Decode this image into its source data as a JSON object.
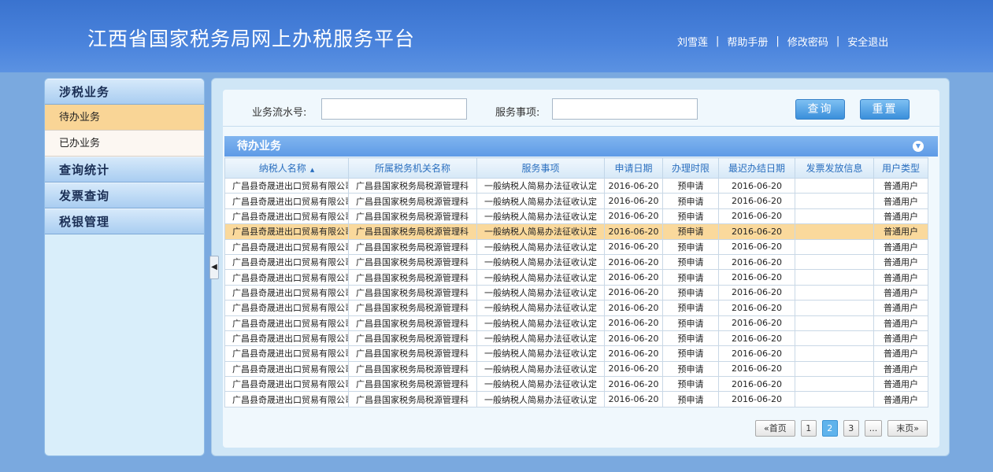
{
  "header": {
    "title": "江西省国家税务局网上办税服务平台",
    "user": "刘雪莲",
    "help": "帮助手册",
    "change_password": "修改密码",
    "logout": "安全退出",
    "separator": "|"
  },
  "sidebar": {
    "section_tax": "涉税业务",
    "item_pending": "待办业务",
    "item_done": "已办业务",
    "section_query": "查询统计",
    "section_invoice": "发票查询",
    "section_bank": "税银管理"
  },
  "search": {
    "serial_label": "业务流水号:",
    "serial_value": "",
    "service_label": "服务事项:",
    "service_value": "",
    "query_button": "查询",
    "reset_button": "重置"
  },
  "panel": {
    "title": "待办业务"
  },
  "table": {
    "columns": [
      "纳税人名称",
      "所属税务机关名称",
      "服务事项",
      "申请日期",
      "办理时限",
      "最迟办结日期",
      "发票发放信息",
      "用户类型"
    ],
    "rows": [
      [
        "广昌县奇晟进出口贸易有限公司",
        "广昌县国家税务局税源管理科",
        "一般纳税人简易办法征收认定",
        "2016-06-20",
        "预申请",
        "2016-06-20",
        "",
        "普通用户"
      ],
      [
        "广昌县奇晟进出口贸易有限公司",
        "广昌县国家税务局税源管理科",
        "一般纳税人简易办法征收认定",
        "2016-06-20",
        "预申请",
        "2016-06-20",
        "",
        "普通用户"
      ],
      [
        "广昌县奇晟进出口贸易有限公司",
        "广昌县国家税务局税源管理科",
        "一般纳税人简易办法征收认定",
        "2016-06-20",
        "预申请",
        "2016-06-20",
        "",
        "普通用户"
      ],
      [
        "广昌县奇晟进出口贸易有限公司",
        "广昌县国家税务局税源管理科",
        "一般纳税人简易办法征收认定",
        "2016-06-20",
        "预申请",
        "2016-06-20",
        "",
        "普通用户"
      ],
      [
        "广昌县奇晟进出口贸易有限公司",
        "广昌县国家税务局税源管理科",
        "一般纳税人简易办法征收认定",
        "2016-06-20",
        "预申请",
        "2016-06-20",
        "",
        "普通用户"
      ],
      [
        "广昌县奇晟进出口贸易有限公司",
        "广昌县国家税务局税源管理科",
        "一般纳税人简易办法征收认定",
        "2016-06-20",
        "预申请",
        "2016-06-20",
        "",
        "普通用户"
      ],
      [
        "广昌县奇晟进出口贸易有限公司",
        "广昌县国家税务局税源管理科",
        "一般纳税人简易办法征收认定",
        "2016-06-20",
        "预申请",
        "2016-06-20",
        "",
        "普通用户"
      ],
      [
        "广昌县奇晟进出口贸易有限公司",
        "广昌县国家税务局税源管理科",
        "一般纳税人简易办法征收认定",
        "2016-06-20",
        "预申请",
        "2016-06-20",
        "",
        "普通用户"
      ],
      [
        "广昌县奇晟进出口贸易有限公司",
        "广昌县国家税务局税源管理科",
        "一般纳税人简易办法征收认定",
        "2016-06-20",
        "预申请",
        "2016-06-20",
        "",
        "普通用户"
      ],
      [
        "广昌县奇晟进出口贸易有限公司",
        "广昌县国家税务局税源管理科",
        "一般纳税人简易办法征收认定",
        "2016-06-20",
        "预申请",
        "2016-06-20",
        "",
        "普通用户"
      ],
      [
        "广昌县奇晟进出口贸易有限公司",
        "广昌县国家税务局税源管理科",
        "一般纳税人简易办法征收认定",
        "2016-06-20",
        "预申请",
        "2016-06-20",
        "",
        "普通用户"
      ],
      [
        "广昌县奇晟进出口贸易有限公司",
        "广昌县国家税务局税源管理科",
        "一般纳税人简易办法征收认定",
        "2016-06-20",
        "预申请",
        "2016-06-20",
        "",
        "普通用户"
      ],
      [
        "广昌县奇晟进出口贸易有限公司",
        "广昌县国家税务局税源管理科",
        "一般纳税人简易办法征收认定",
        "2016-06-20",
        "预申请",
        "2016-06-20",
        "",
        "普通用户"
      ],
      [
        "广昌县奇晟进出口贸易有限公司",
        "广昌县国家税务局税源管理科",
        "一般纳税人简易办法征收认定",
        "2016-06-20",
        "预申请",
        "2016-06-20",
        "",
        "普通用户"
      ],
      [
        "广昌县奇晟进出口贸易有限公司",
        "广昌县国家税务局税源管理科",
        "一般纳税人简易办法征收认定",
        "2016-06-20",
        "预申请",
        "2016-06-20",
        "",
        "普通用户"
      ]
    ],
    "highlighted_row": 3
  },
  "pager": {
    "first": "«首页",
    "pages": [
      "1",
      "2",
      "3",
      "..."
    ],
    "current": "2",
    "last": "末页»"
  }
}
